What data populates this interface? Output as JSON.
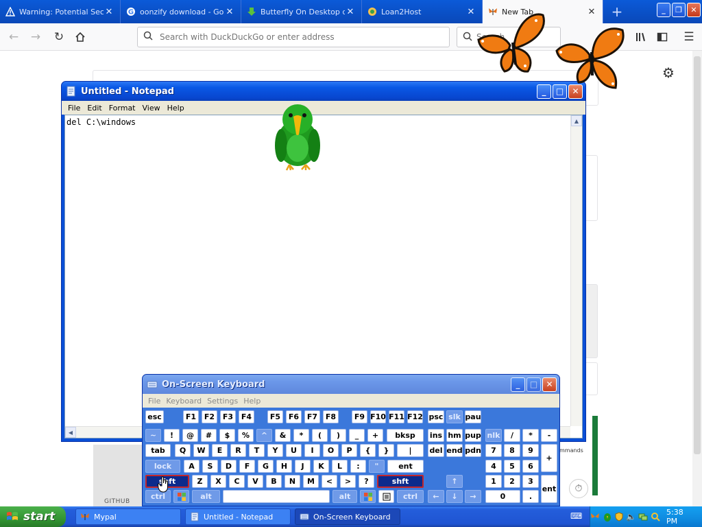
{
  "browser": {
    "tabs": [
      {
        "label": "Warning: Potential Sec",
        "icon": "warning-icon"
      },
      {
        "label": "oonzify download - Goo",
        "icon": "google-icon"
      },
      {
        "label": "Butterfly On Desktop do",
        "icon": "download-arrow-icon"
      },
      {
        "label": "Loan2Host",
        "icon": "loan2host-icon"
      },
      {
        "label": "New Tab",
        "icon": "butterfly-icon"
      }
    ],
    "url_placeholder": "Search with DuckDuckGo or enter address",
    "search_placeholder": "Search",
    "footer_label": "GITHUB",
    "commands_label": "mmands"
  },
  "notepad": {
    "title": "Untitled - Notepad",
    "menu": [
      "File",
      "Edit",
      "Format",
      "View",
      "Help"
    ],
    "content": "del C:\\windows"
  },
  "osk": {
    "title": "On-Screen Keyboard",
    "menu": [
      "File",
      "Keyboard",
      "Settings",
      "Help"
    ],
    "keys": {
      "esc": "esc",
      "f1": "F1",
      "f2": "F2",
      "f3": "F3",
      "f4": "F4",
      "f5": "F5",
      "f6": "F6",
      "f7": "F7",
      "f8": "F8",
      "f9": "F9",
      "f10": "F10",
      "f11": "F11",
      "f12": "F12",
      "psc": "psc",
      "slk": "slk",
      "pau": "pau",
      "tilde": "~",
      "n1": "!",
      "n2": "@",
      "n3": "#",
      "n4": "$",
      "n5": "%",
      "n6": "^",
      "n7": "&",
      "n8": "*",
      "n9": "(",
      "n0": ")",
      "minus": "_",
      "plus": "+",
      "bksp": "bksp",
      "ins": "ins",
      "hm": "hm",
      "pup": "pup",
      "nlk": "nlk",
      "kdiv": "/",
      "kmul": "*",
      "ksub": "-",
      "tab": "tab",
      "q": "Q",
      "w": "W",
      "e": "E",
      "r": "R",
      "t": "T",
      "y": "Y",
      "u": "U",
      "i": "I",
      "o": "O",
      "p": "P",
      "lbr": "{",
      "rbr": "}",
      "pipe": "|",
      "del": "del",
      "end": "end",
      "pdn": "pdn",
      "k7": "7",
      "k8": "8",
      "k9": "9",
      "kadd": "+",
      "lock": "lock",
      "a": "A",
      "s": "S",
      "d": "D",
      "f": "F",
      "g": "G",
      "h": "H",
      "j": "J",
      "k": "K",
      "l": "L",
      "colon": ":",
      "quote": "\"",
      "ent": "ent",
      "k4": "4",
      "k5": "5",
      "k6": "6",
      "shft": "shft",
      "z": "Z",
      "x": "X",
      "c": "C",
      "v": "V",
      "b": "B",
      "n": "N",
      "m": "M",
      "lt": "<",
      "gt": ">",
      "qm": "?",
      "shft2": "shft",
      "up": "↑",
      "k1": "1",
      "k2": "2",
      "k3": "3",
      "kent": "ent",
      "ctrl": "ctrl",
      "alt": "alt",
      "alt2": "alt",
      "ctrl2": "ctrl",
      "left": "←",
      "down": "↓",
      "right": "→",
      "k0": "0",
      "kdot": "."
    }
  },
  "taskbar": {
    "start": "start",
    "items": [
      {
        "label": "Mypal"
      },
      {
        "label": "Untitled - Notepad"
      },
      {
        "label": "On-Screen Keyboard"
      }
    ],
    "clock": "5:38 PM"
  },
  "colors": {
    "xp_blue": "#0a58e5",
    "taskbar_blue": "#245edb",
    "start_green": "#2f8f2f",
    "butterfly_orange": "#f07b12"
  }
}
